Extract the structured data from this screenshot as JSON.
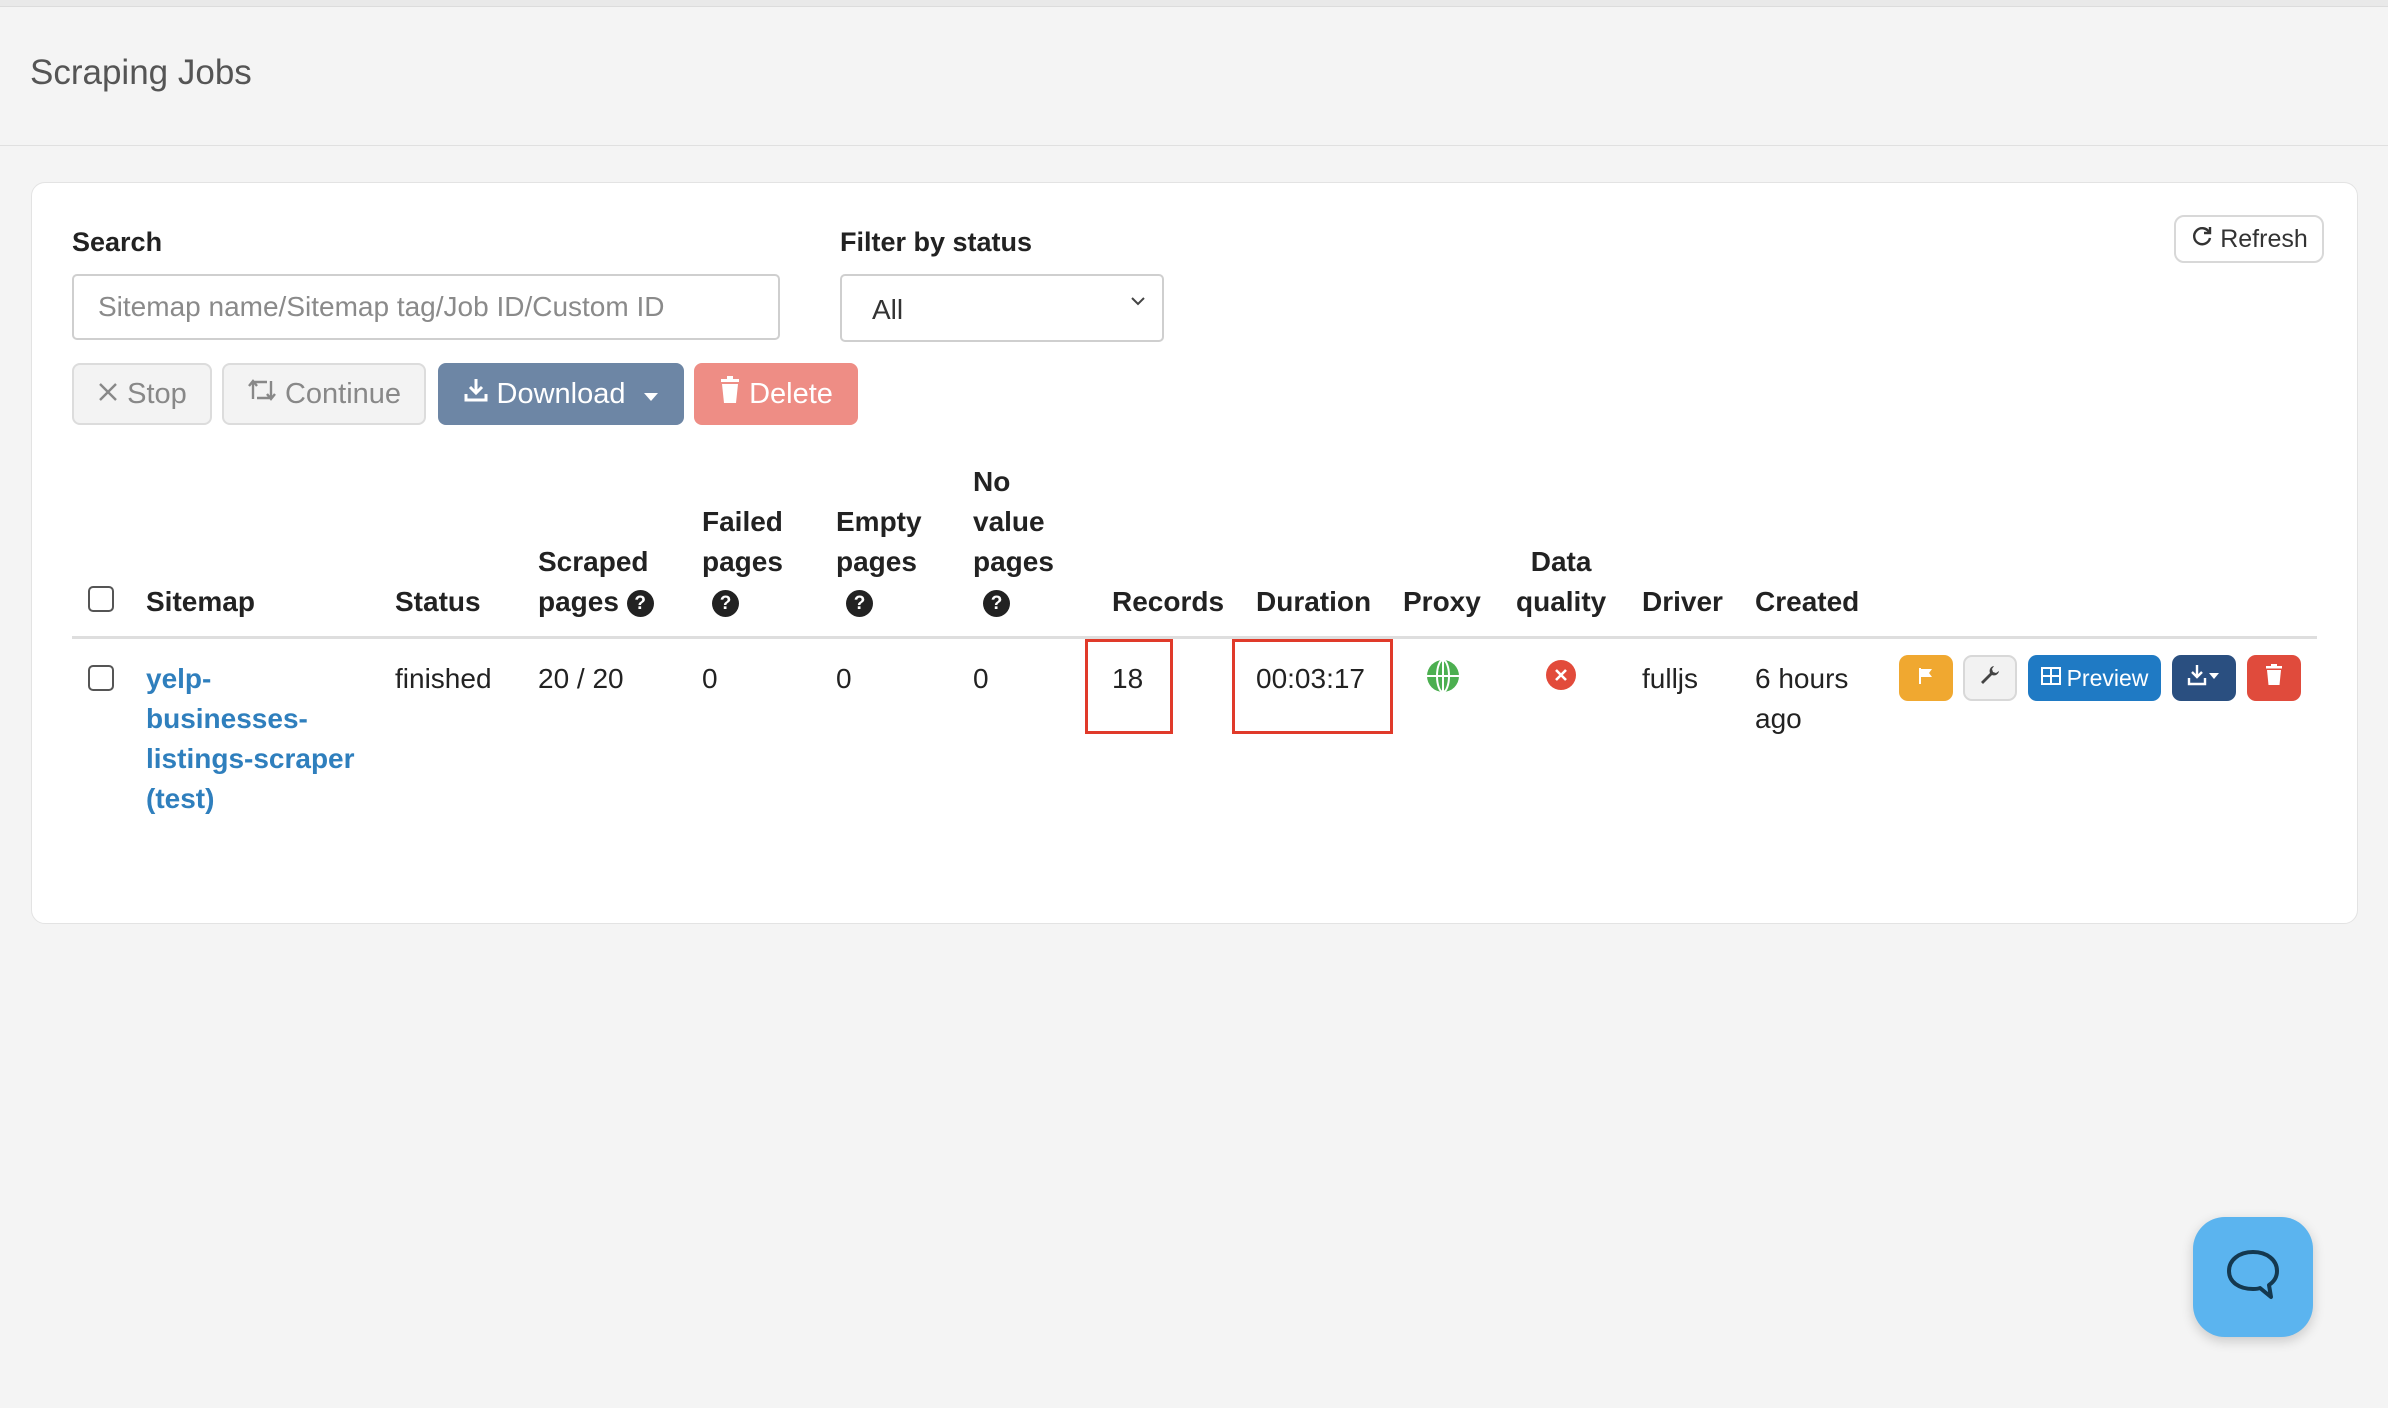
{
  "page": {
    "title": "Scraping Jobs"
  },
  "filters": {
    "search_label": "Search",
    "search_placeholder": "Sitemap name/Sitemap tag/Job ID/Custom ID",
    "status_label": "Filter by status",
    "status_value": "All",
    "refresh_label": "Refresh"
  },
  "actions": {
    "stop": "Stop",
    "continue": "Continue",
    "download": "Download",
    "delete": "Delete"
  },
  "table": {
    "headers": {
      "sitemap": "Sitemap",
      "status": "Status",
      "scraped_1": "Scraped",
      "scraped_2": "pages",
      "failed_1": "Failed",
      "failed_2": "pages",
      "empty_1": "Empty",
      "empty_2": "pages",
      "novalue_1": "No",
      "novalue_2": "value",
      "novalue_3": "pages",
      "records": "Records",
      "duration": "Duration",
      "proxy": "Proxy",
      "dq_1": "Data",
      "dq_2": "quality",
      "driver": "Driver",
      "created": "Created"
    },
    "rows": [
      {
        "sitemap_lines": [
          "yelp-",
          "businesses-",
          "listings-scraper",
          "(test)"
        ],
        "status": "finished",
        "scraped_pages": "20 / 20",
        "failed_pages": "0",
        "empty_pages": "0",
        "no_value_pages": "0",
        "records": "18",
        "duration": "00:03:17",
        "driver": "fulljs",
        "created_lines": [
          "6 hours",
          "ago"
        ],
        "preview_label": "Preview"
      }
    ]
  },
  "colors": {
    "link": "#2f7fbd",
    "highlight": "#e03a2a",
    "proxy_icon": "#4caf50",
    "data_quality_bad": "#e24b3b",
    "flag_button": "#f0a830",
    "preview_button": "#1f7ac4",
    "download_button": "#2a4f80",
    "delete_button": "#e04b3c",
    "chat_button": "#5bb4ef"
  }
}
